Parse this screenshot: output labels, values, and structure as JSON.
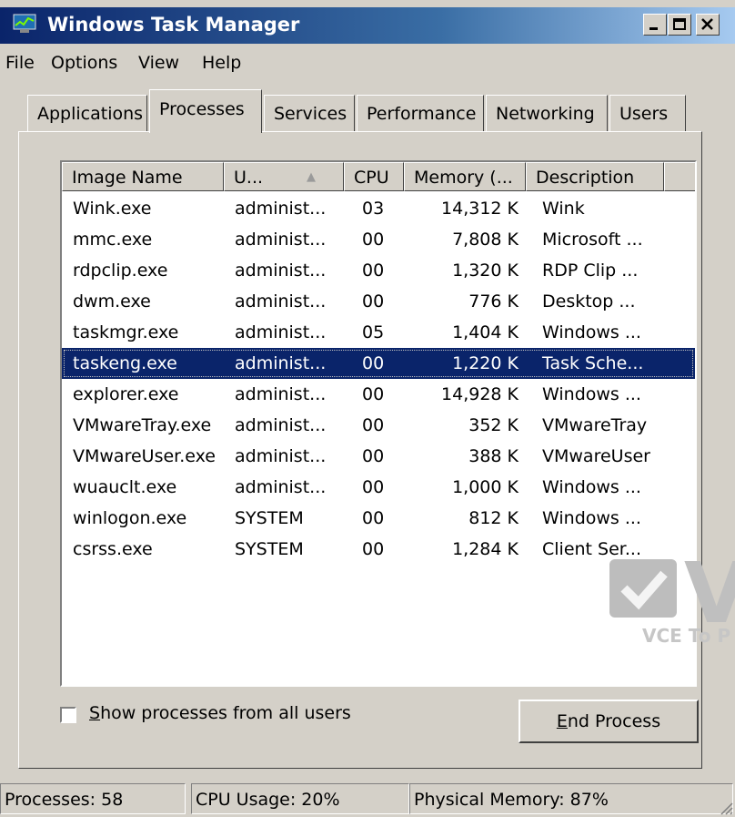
{
  "window": {
    "title": "Windows Task Manager"
  },
  "menu": [
    "File",
    "Options",
    "View",
    "Help"
  ],
  "tabs": [
    "Applications",
    "Processes",
    "Services",
    "Performance",
    "Networking",
    "Users"
  ],
  "active_tab": "Processes",
  "columns": [
    "Image Name",
    "U...",
    "CPU",
    "Memory (...",
    "Description"
  ],
  "rows": [
    {
      "name": "Wink.exe",
      "user": "administ...",
      "cpu": "03",
      "mem": "14,312 K",
      "desc": "Wink"
    },
    {
      "name": "mmc.exe",
      "user": "administ...",
      "cpu": "00",
      "mem": "7,808 K",
      "desc": "Microsoft ..."
    },
    {
      "name": "rdpclip.exe",
      "user": "administ...",
      "cpu": "00",
      "mem": "1,320 K",
      "desc": "RDP Clip ..."
    },
    {
      "name": "dwm.exe",
      "user": "administ...",
      "cpu": "00",
      "mem": "776 K",
      "desc": "Desktop ..."
    },
    {
      "name": "taskmgr.exe",
      "user": "administ...",
      "cpu": "05",
      "mem": "1,404 K",
      "desc": "Windows ..."
    },
    {
      "name": "taskeng.exe",
      "user": "administ...",
      "cpu": "00",
      "mem": "1,220 K",
      "desc": "Task Sche...",
      "selected": true
    },
    {
      "name": "explorer.exe",
      "user": "administ...",
      "cpu": "00",
      "mem": "14,928 K",
      "desc": "Windows ..."
    },
    {
      "name": "VMwareTray.exe",
      "user": "administ...",
      "cpu": "00",
      "mem": "352 K",
      "desc": "VMwareTray"
    },
    {
      "name": "VMwareUser.exe",
      "user": "administ...",
      "cpu": "00",
      "mem": "388 K",
      "desc": "VMwareUser"
    },
    {
      "name": "wuauclt.exe",
      "user": "administ...",
      "cpu": "00",
      "mem": "1,000 K",
      "desc": "Windows ..."
    },
    {
      "name": "winlogon.exe",
      "user": "SYSTEM",
      "cpu": "00",
      "mem": "812 K",
      "desc": "Windows ..."
    },
    {
      "name": "csrss.exe",
      "user": "SYSTEM",
      "cpu": "00",
      "mem": "1,284 K",
      "desc": "Client Ser..."
    }
  ],
  "checkbox": {
    "rest": "how processes from all users",
    "mnemonic": "S",
    "checked": false
  },
  "end_button": {
    "mnemonic": "E",
    "rest": "nd Process"
  },
  "status": {
    "processes": "Processes: 58",
    "cpu": "CPU Usage: 20%",
    "memory": "Physical Memory: 87%"
  },
  "watermark": {
    "text": "VCE To P",
    "letter": "V"
  },
  "colors": {
    "title_start": "#0a246a",
    "title_end": "#a6caf0",
    "selection": "#0a246a",
    "face": "#d4d0c8"
  }
}
